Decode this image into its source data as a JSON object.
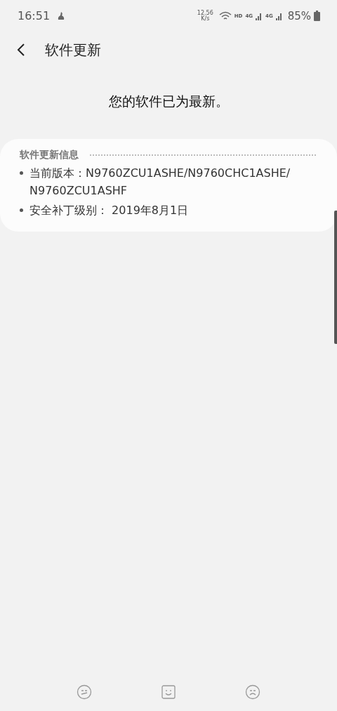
{
  "status_bar": {
    "time": "16:51",
    "speed_value": "12.56",
    "speed_unit": "K/s",
    "hd": "HD",
    "network_1": "4G",
    "network_2": "4G",
    "battery": "85%"
  },
  "header": {
    "title": "软件更新"
  },
  "message": "您的软件已为最新。",
  "info_card": {
    "heading": "软件更新信息",
    "items": [
      {
        "label": "当前版本：",
        "value": "N9760ZCU1ASHE/N9760CHC1ASHE/N9760ZCU1ASHF"
      },
      {
        "label": "安全补丁级别：",
        "value": " 2019年8月1日"
      }
    ]
  }
}
